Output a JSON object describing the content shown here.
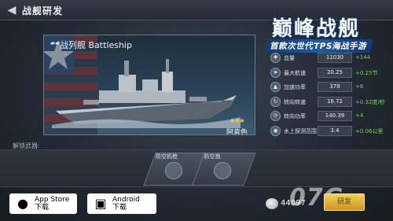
{
  "header": {
    "title": "战舰研发",
    "back_icon": "back-arrow-icon"
  },
  "logo": {
    "title": "巅峰战舰",
    "subtitle": "首款次世代TPS海战手游"
  },
  "ship": {
    "name": "战列舰 Battleship",
    "stars": "★★★",
    "country": "阿肯色"
  },
  "stats": [
    {
      "label": "血量",
      "value": "11030",
      "bonus": "+144",
      "icon": "health-icon"
    },
    {
      "label": "最大航速",
      "value": "20.25",
      "bonus": "+0.25节",
      "icon": "speed-icon"
    },
    {
      "label": "加速功率",
      "value": "378",
      "bonus": "+6",
      "icon": "accel-icon"
    },
    {
      "label": "转向转速",
      "value": "16.72",
      "bonus": "+0.32度/秒",
      "icon": "turn-icon"
    },
    {
      "label": "转向功率",
      "value": "140.39",
      "bonus": "+4",
      "icon": "turn-power-icon"
    },
    {
      "label": "水上探测范围",
      "value": "3.4",
      "bonus": "+0.06公里",
      "icon": "detect-icon"
    }
  ],
  "weapons": {
    "label": "解锁武器:",
    "items": [
      {
        "name": "防空机枪"
      },
      {
        "name": "防空炮"
      }
    ]
  },
  "store": {
    "appstore_line1": "App Store",
    "appstore_line2": "下载",
    "android_line1": "Android",
    "android_line2": "下载"
  },
  "coins": {
    "value": "44097"
  },
  "research_button": "研发",
  "watermark": "07G"
}
